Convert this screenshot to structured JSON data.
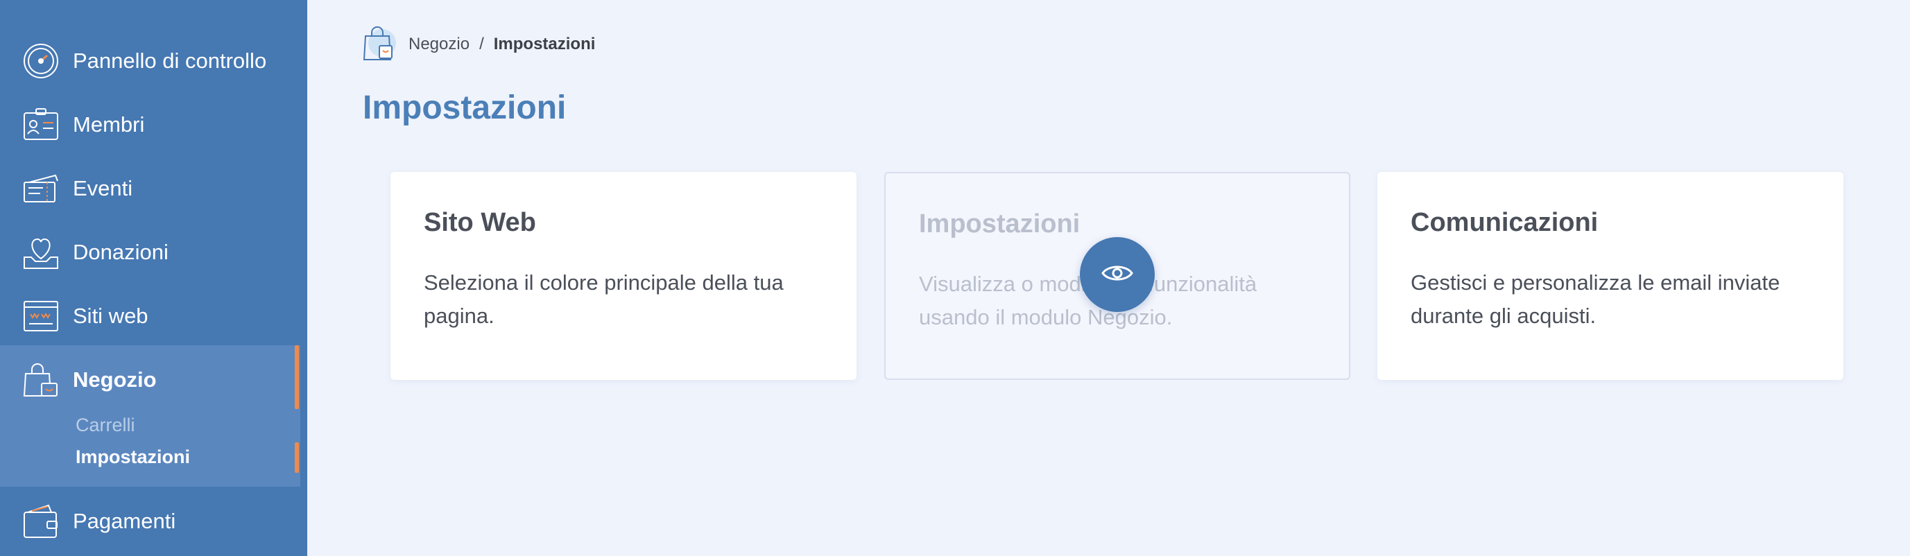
{
  "sidebar": {
    "items": [
      {
        "label": "Pannello di controllo",
        "icon": "speedometer-icon"
      },
      {
        "label": "Membri",
        "icon": "id-card-icon"
      },
      {
        "label": "Eventi",
        "icon": "tickets-icon"
      },
      {
        "label": "Donazioni",
        "icon": "heart-box-icon"
      },
      {
        "label": "Siti web",
        "icon": "browser-window-icon"
      },
      {
        "label": "Negozio",
        "icon": "shopping-bag-icon"
      },
      {
        "label": "Pagamenti",
        "icon": "wallet-icon"
      }
    ],
    "active_item": "Negozio",
    "sub_items": [
      {
        "label": "Carrelli"
      },
      {
        "label": "Impostazioni"
      }
    ]
  },
  "breadcrumb": {
    "parent": "Negozio",
    "separator": "/",
    "current": "Impostazioni"
  },
  "page": {
    "title": "Impostazioni"
  },
  "cards": [
    {
      "title": "Sito Web",
      "description": "Seleziona il colore principale della tua pagina."
    },
    {
      "title": "Impostazioni",
      "description": "Visualizza o modifica le funzionalità usando il modulo Negozio."
    },
    {
      "title": "Comunicazioni",
      "description": "Gestisci e personalizza le email inviate durante gli acquisti."
    }
  ],
  "colors": {
    "sidebar_bg": "#4678b2",
    "sidebar_active_bg": "#5b87bf",
    "accent_orange": "#f08a4b",
    "title_blue": "#4b7fb7",
    "page_bg": "#eff3fc"
  }
}
